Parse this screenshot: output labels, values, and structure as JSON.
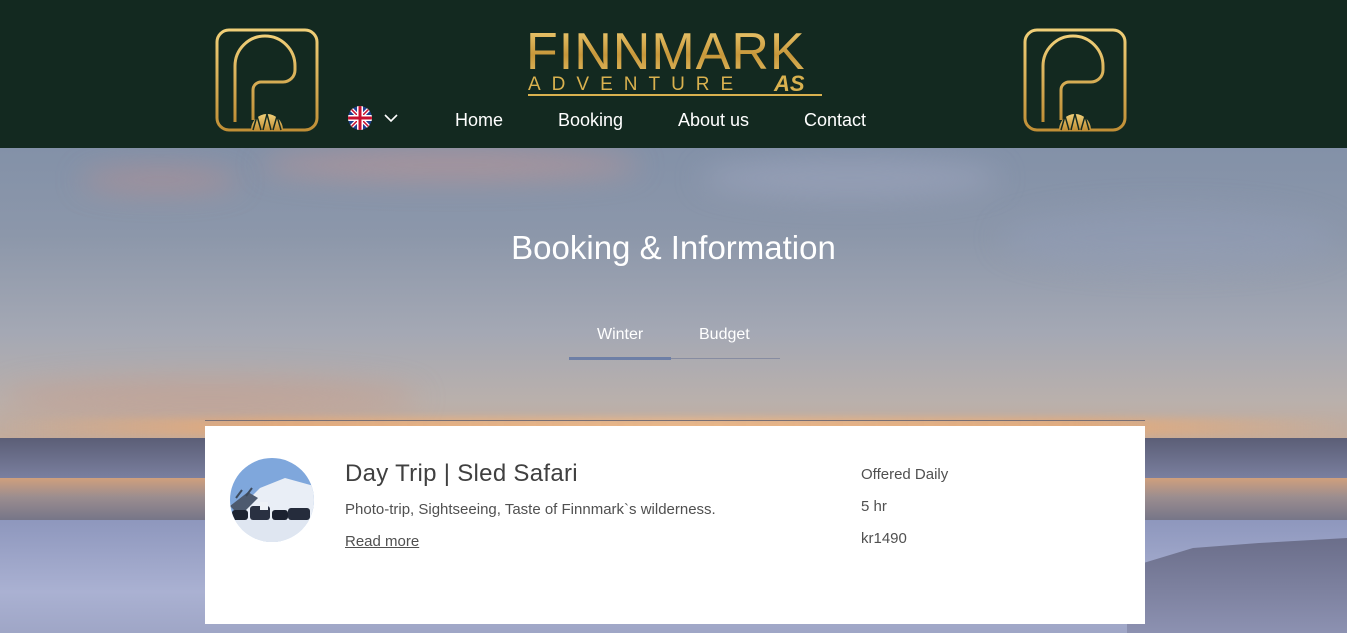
{
  "brand": {
    "title": "FINNMARK",
    "subtitle": "ADVENTURE",
    "suffix": "AS"
  },
  "language": {
    "selected_flag": "uk-flag-icon",
    "dropdown_icon": "chevron-down-icon"
  },
  "nav": {
    "items": [
      {
        "label": "Home"
      },
      {
        "label": "Booking"
      },
      {
        "label": "About us"
      },
      {
        "label": "Contact"
      }
    ]
  },
  "page": {
    "title": "Booking & Information"
  },
  "tabs": {
    "items": [
      {
        "label": "Winter",
        "active": true
      },
      {
        "label": "Budget",
        "active": false
      }
    ]
  },
  "services": [
    {
      "title": "Day Trip | Sled Safari",
      "description": "Photo-trip, Sightseeing, Taste of Finnmark`s wilderness.",
      "link": "Read more",
      "availability": "Offered Daily",
      "duration": "5 hr",
      "price": "kr1490"
    }
  ],
  "colors": {
    "header_bg": "#132920",
    "brand_gold": "#d9b14f",
    "tab_active": "#6e7fa6"
  }
}
